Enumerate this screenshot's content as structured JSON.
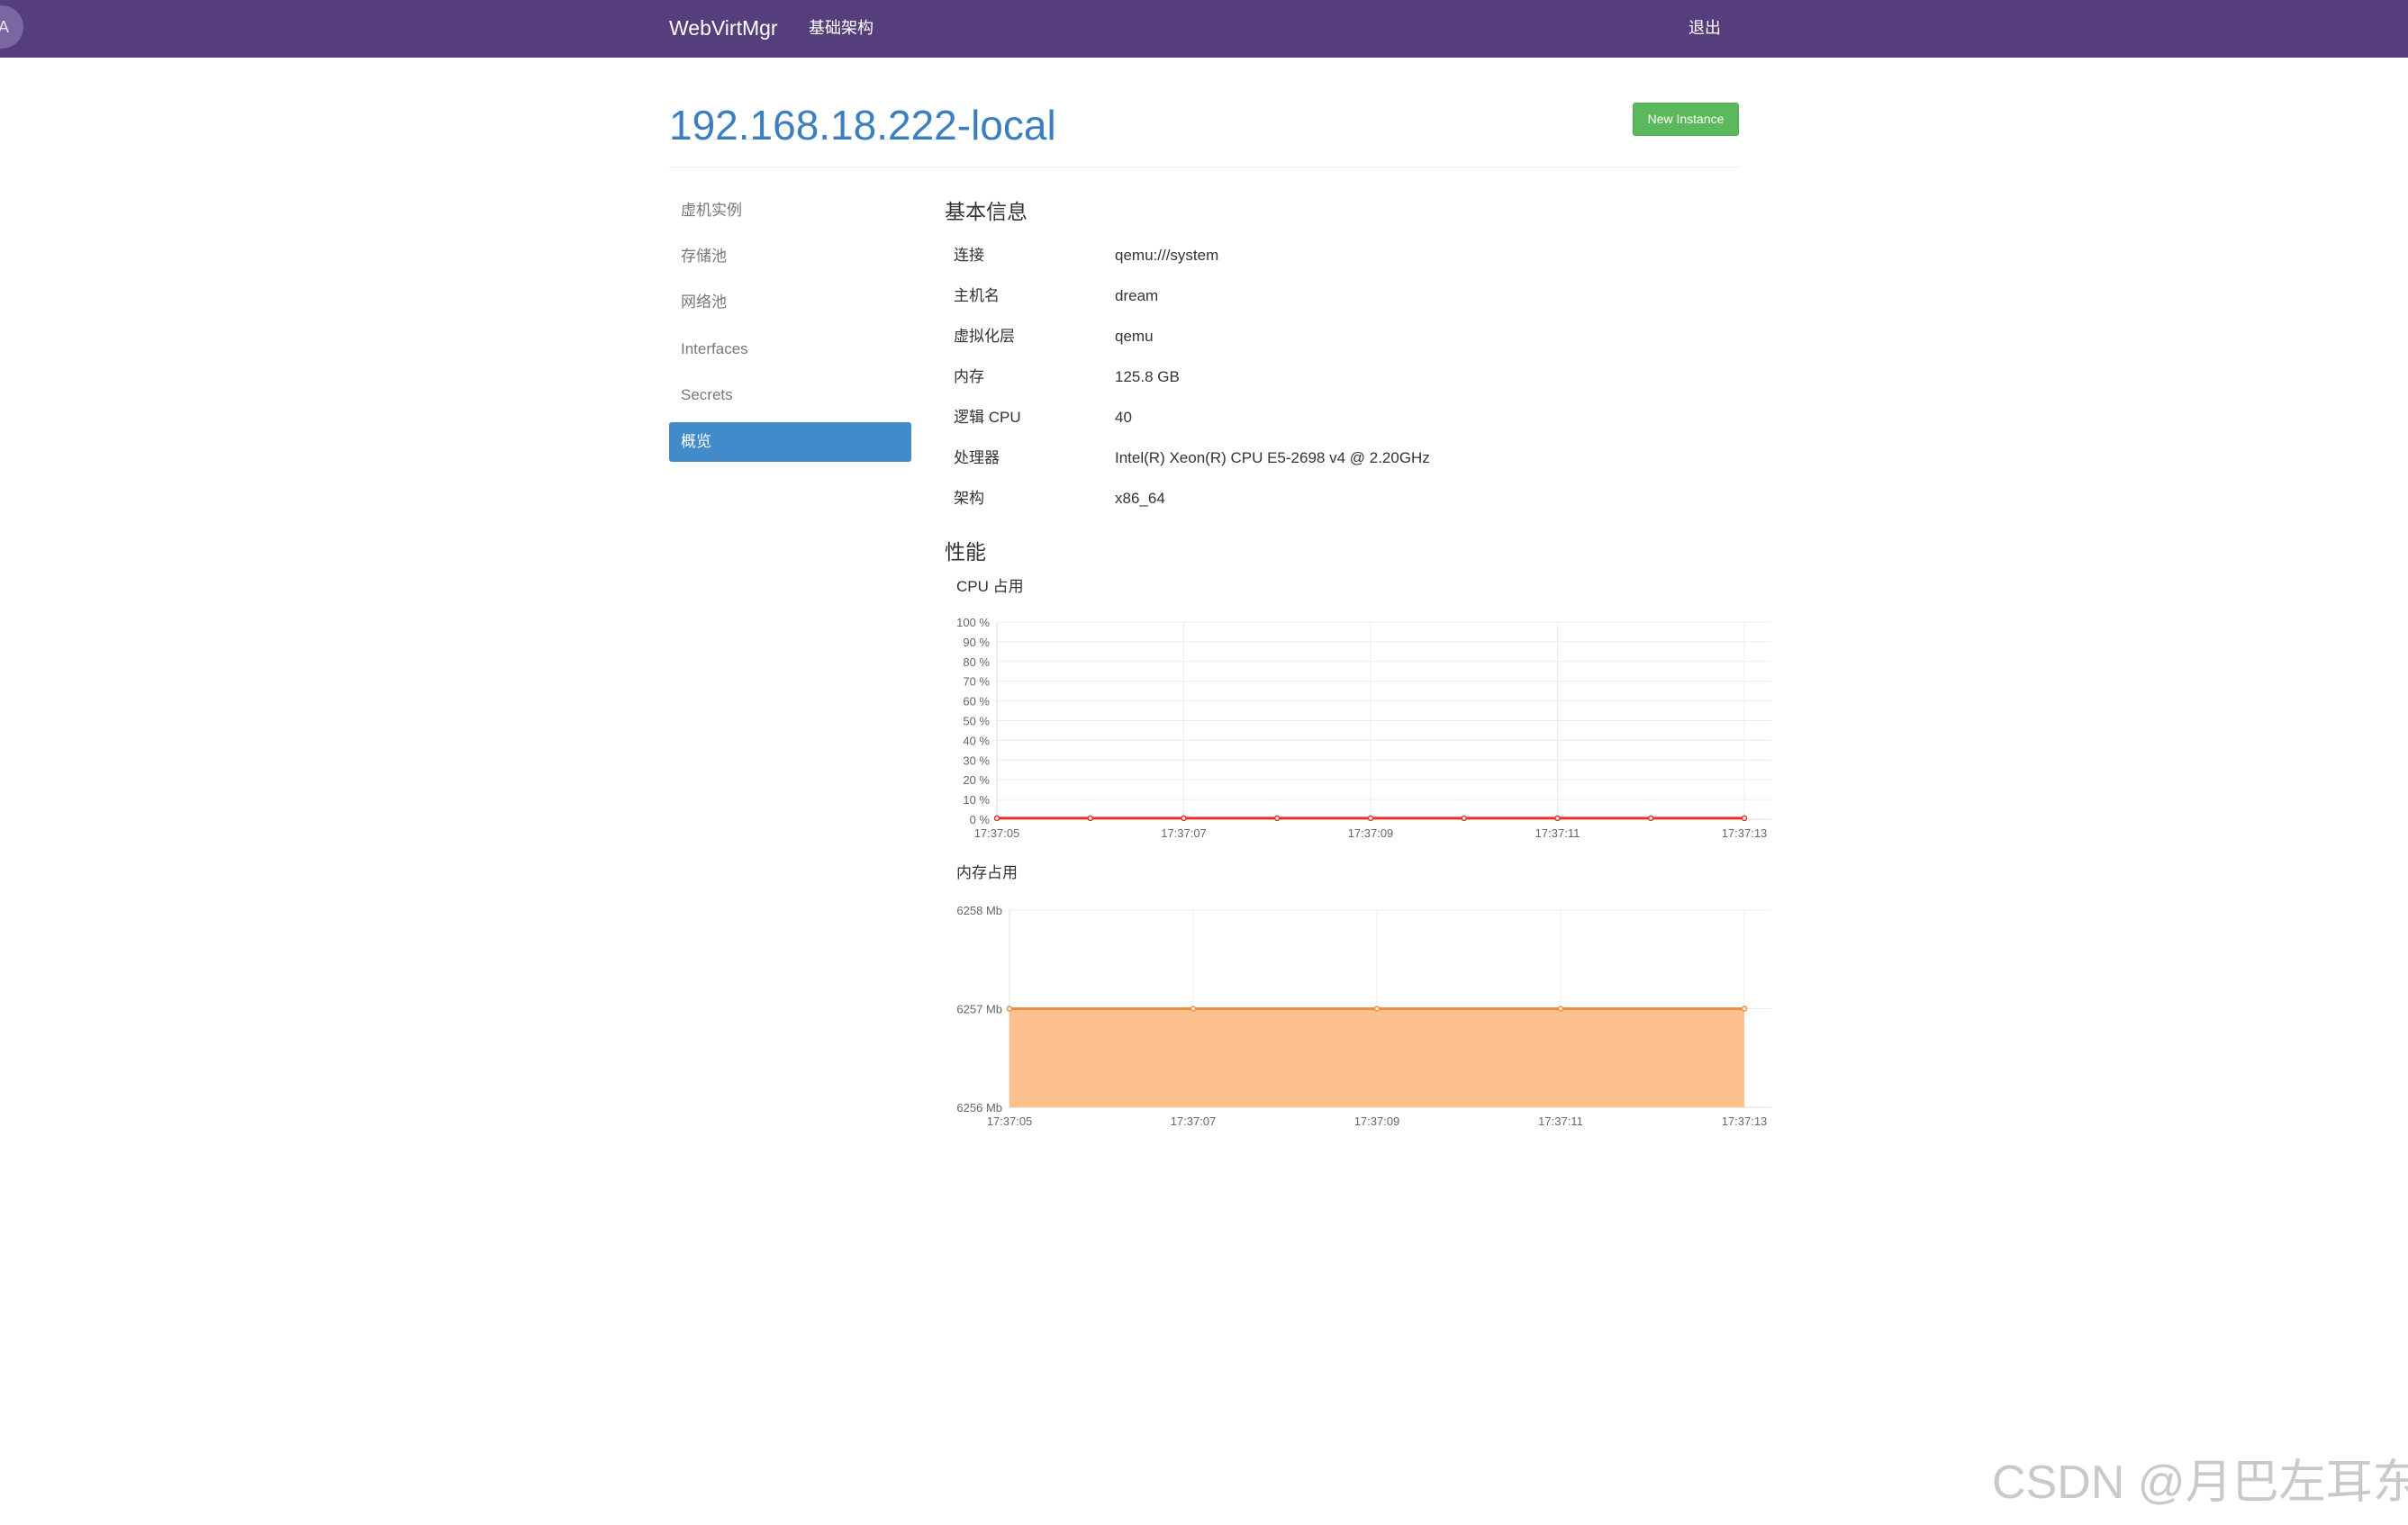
{
  "navbar": {
    "avatar_letter": "A",
    "brand": "WebVirtMgr",
    "infrastructure": "基础架构",
    "logout": "退出"
  },
  "header": {
    "title": "192.168.18.222-local",
    "new_instance": "New Instance"
  },
  "sidebar": {
    "items": [
      {
        "label": "虚机实例",
        "active": false
      },
      {
        "label": "存储池",
        "active": false
      },
      {
        "label": "网络池",
        "active": false
      },
      {
        "label": "Interfaces",
        "active": false
      },
      {
        "label": "Secrets",
        "active": false
      },
      {
        "label": "概览",
        "active": true
      }
    ]
  },
  "basic_info": {
    "title": "基本信息",
    "rows": [
      {
        "label": "连接",
        "value": "qemu:///system"
      },
      {
        "label": "主机名",
        "value": "dream"
      },
      {
        "label": "虚拟化层",
        "value": "qemu"
      },
      {
        "label": "内存",
        "value": "125.8 GB"
      },
      {
        "label": "逻辑 CPU",
        "value": "40"
      },
      {
        "label": "处理器",
        "value": "Intel(R) Xeon(R) CPU E5-2698 v4 @ 2.20GHz"
      },
      {
        "label": "架构",
        "value": "x86_64"
      }
    ]
  },
  "performance": {
    "title": "性能"
  },
  "colors": {
    "navbar": "#563d7c",
    "title": "#3c7fc1",
    "active_nav": "#428bca",
    "success": "#5cb85c",
    "cpu_line": "#e8312f",
    "mem_fill": "#fdc18e",
    "mem_line": "#f08d3c"
  },
  "chart_data": [
    {
      "type": "line",
      "title": "CPU 占用",
      "x": [
        "17:37:05",
        "17:37:06",
        "17:37:07",
        "17:37:08",
        "17:37:09",
        "17:37:10",
        "17:37:11",
        "17:37:12",
        "17:37:13"
      ],
      "xticks": [
        "17:37:05",
        "17:37:07",
        "17:37:09",
        "17:37:11",
        "17:37:13"
      ],
      "yticks": [
        "0 %",
        "10 %",
        "20 %",
        "30 %",
        "40 %",
        "50 %",
        "60 %",
        "70 %",
        "80 %",
        "90 %",
        "100 %"
      ],
      "series": [
        {
          "values": [
            0.5,
            0.5,
            0.5,
            0.5,
            0.5,
            0.5,
            0.5,
            0.5,
            0.5
          ]
        }
      ],
      "ylim": [
        0,
        100
      ],
      "grid": true
    },
    {
      "type": "area",
      "title": "内存占用",
      "x": [
        "17:37:05",
        "17:37:07",
        "17:37:09",
        "17:37:11",
        "17:37:13"
      ],
      "xticks": [
        "17:37:05",
        "17:37:07",
        "17:37:09",
        "17:37:11",
        "17:37:13"
      ],
      "yticks": [
        "6256 Mb",
        "6257 Mb",
        "6258 Mb"
      ],
      "series": [
        {
          "values": [
            6257,
            6257,
            6257,
            6257,
            6257
          ]
        }
      ],
      "ylim": [
        6256,
        6258
      ],
      "grid": true
    }
  ],
  "watermark": "CSDN @月巴左耳东"
}
